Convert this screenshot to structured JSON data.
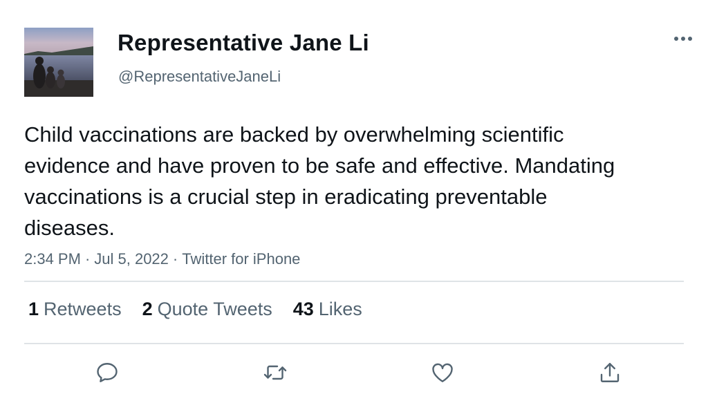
{
  "author": {
    "display_name": "Representative Jane Li",
    "handle": "@RepresentativeJaneLi",
    "avatar": "avatar-photo-lake-sunset"
  },
  "tweet": {
    "text": "Child vaccinations are backed by overwhelming scientific evidence and have proven to be safe and effective. Mandating vaccinations is a crucial step in eradicating preventable diseases.",
    "time": "2:34 PM",
    "date": "Jul 5, 2022",
    "source": "Twitter for iPhone",
    "separator": "·"
  },
  "stats": {
    "retweets_count": "1",
    "retweets_label": "Retweets",
    "quotes_count": "2",
    "quotes_label": "Quote Tweets",
    "likes_count": "43",
    "likes_label": "Likes"
  },
  "actions": [
    "reply-icon",
    "retweet-icon",
    "like-icon",
    "share-icon"
  ],
  "colors": {
    "text": "#0f1419",
    "secondary": "#536471",
    "divider": "#dfe3e6",
    "icon": "#536471"
  }
}
